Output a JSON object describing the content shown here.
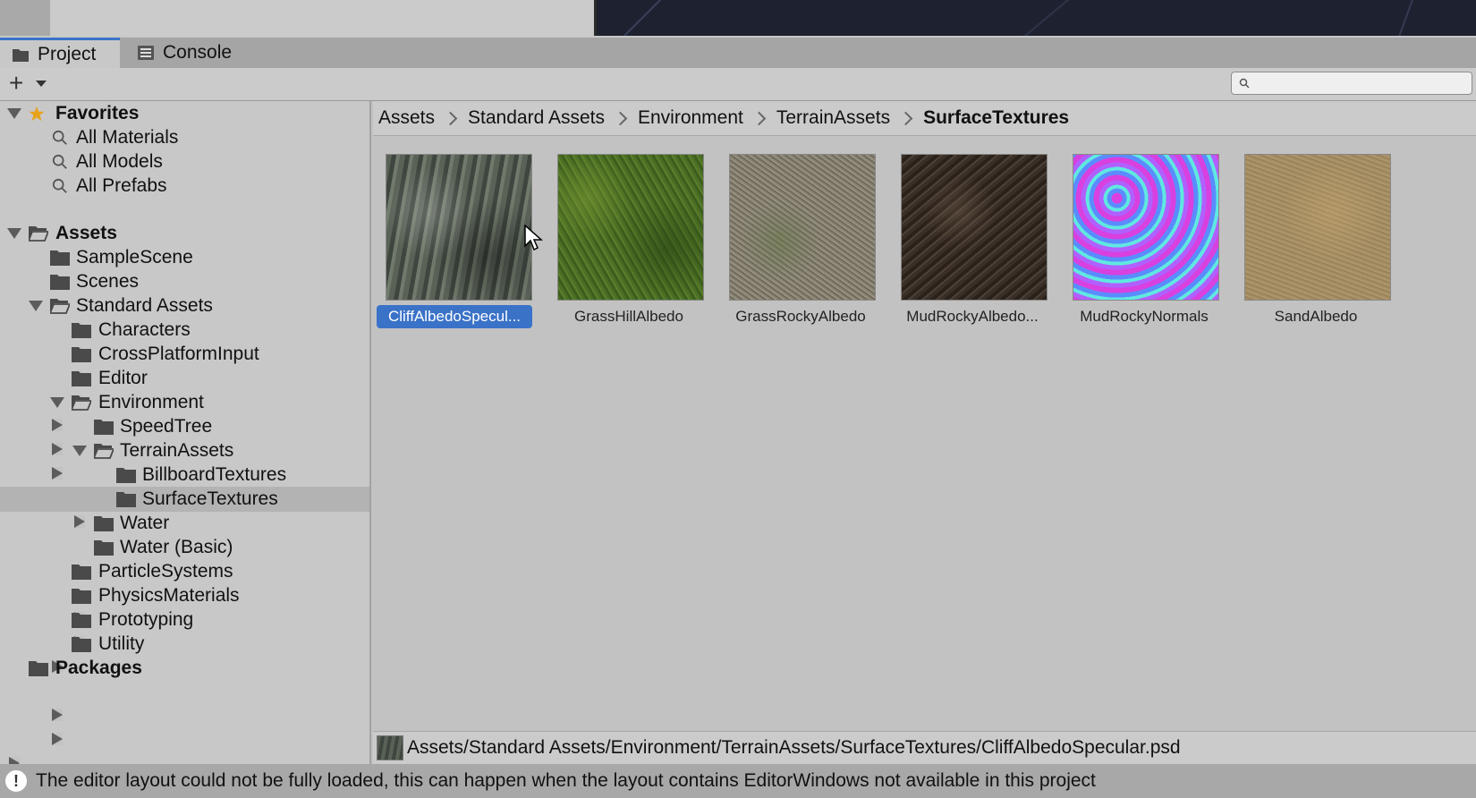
{
  "tabs": [
    {
      "label": "Project",
      "active": true
    },
    {
      "label": "Console",
      "active": false
    }
  ],
  "toolbar": {
    "add_label": "+",
    "search_placeholder": ""
  },
  "tree": {
    "favorites": {
      "label": "Favorites",
      "items": [
        "All Materials",
        "All Models",
        "All Prefabs"
      ]
    },
    "assets": {
      "label": "Assets",
      "items": [
        "SampleScene",
        "Scenes",
        "Standard Assets",
        "Characters",
        "CrossPlatformInput",
        "Editor",
        "Environment",
        "SpeedTree",
        "TerrainAssets",
        "BillboardTextures",
        "SurfaceTextures",
        "Water",
        "Water (Basic)",
        "ParticleSystems",
        "PhysicsMaterials",
        "Prototyping",
        "Utility"
      ]
    },
    "packages": {
      "label": "Packages"
    },
    "selected": "SurfaceTextures"
  },
  "breadcrumb": [
    "Assets",
    "Standard Assets",
    "Environment",
    "TerrainAssets",
    "SurfaceTextures"
  ],
  "assets_grid": [
    {
      "name": "CliffAlbedoSpecul...",
      "selected": true,
      "texture": "cliff"
    },
    {
      "name": "GrassHillAlbedo",
      "selected": false,
      "texture": "grass"
    },
    {
      "name": "GrassRockyAlbedo",
      "selected": false,
      "texture": "grassrocky"
    },
    {
      "name": "MudRockyAlbedo...",
      "selected": false,
      "texture": "mud"
    },
    {
      "name": "MudRockyNormals",
      "selected": false,
      "texture": "normals"
    },
    {
      "name": "SandAlbedo",
      "selected": false,
      "texture": "sand"
    }
  ],
  "selected_path": "Assets/Standard Assets/Environment/TerrainAssets/SurfaceTextures/CliffAlbedoSpecular.psd",
  "status_message": "The editor layout could not be fully loaded, this can happen when the layout contains EditorWindows not available in this project",
  "colors": {
    "accent": "#3a72c8",
    "panel_bg": "#c8c8c8",
    "favorites_star": "#e8a21c"
  }
}
